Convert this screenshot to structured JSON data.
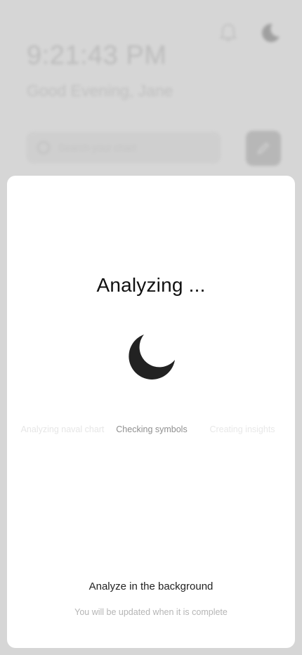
{
  "background": {
    "time": "9:21:43 PM",
    "greeting": "Good Evening, Jane",
    "search_placeholder": "Search your chart",
    "icons": {
      "notifications": "bell-icon",
      "theme": "moon-icon",
      "search": "search-icon",
      "edit": "pencil-icon"
    }
  },
  "modal": {
    "title": "Analyzing ...",
    "loader_icon": "moon-icon",
    "steps": [
      {
        "label": "Analyzing naval chart",
        "state": "done"
      },
      {
        "label": "Checking symbols",
        "state": "active"
      },
      {
        "label": "Creating insights",
        "state": "pending"
      }
    ],
    "background_action_label": "Analyze in the background",
    "background_action_subtext": "You will be updated when it is complete"
  },
  "colors": {
    "overlay": "#d6d6d6",
    "modal_bg": "#ffffff",
    "moon": "#222222",
    "active_step": "#8f8f8f",
    "inactive_step": "#e6e6e6"
  }
}
